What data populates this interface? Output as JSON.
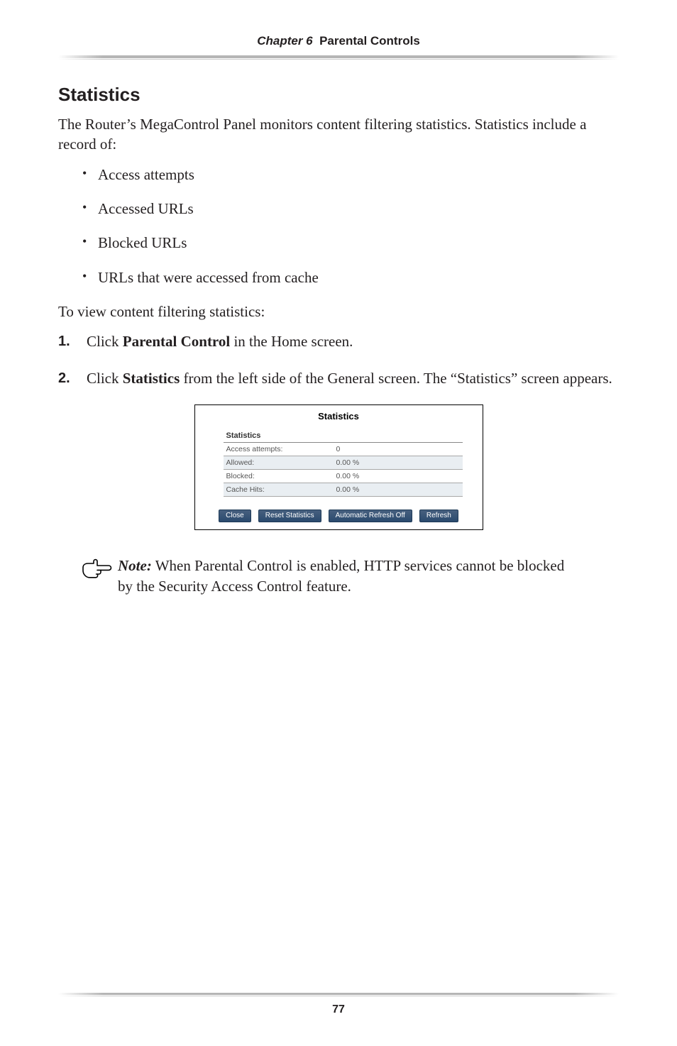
{
  "header": {
    "chapter": "Chapter 6",
    "title": "Parental Controls"
  },
  "section_heading": "Statistics",
  "intro": "The Router’s MegaControl Panel monitors content filtering statistics. Statistics include a record of:",
  "bullets": [
    "Access attempts",
    "Accessed URLs",
    "Blocked URLs",
    "URLs that were accessed from cache"
  ],
  "lead_in": "To view content filtering statistics:",
  "steps": [
    {
      "pre": "Click ",
      "bold": "Parental Control",
      "post": " in the Home screen."
    },
    {
      "pre": "Click ",
      "bold": "Statistics",
      "post": " from the left side of the General screen. The “Statistics” screen appears."
    }
  ],
  "screenshot": {
    "title": "Statistics",
    "subhead": "Statistics",
    "rows": [
      {
        "label": "Access attempts:",
        "value": "0"
      },
      {
        "label": "Allowed:",
        "value": "0.00 %"
      },
      {
        "label": "Blocked:",
        "value": "0.00 %"
      },
      {
        "label": "Cache Hits:",
        "value": "0.00 %"
      }
    ],
    "buttons": {
      "close": "Close",
      "reset": "Reset Statistics",
      "auto": "Automatic Refresh Off",
      "refresh": "Refresh"
    }
  },
  "note": {
    "label": "Note:",
    "text": " When Parental Control is enabled, HTTP services cannot be blocked by the Security Access Control feature."
  },
  "page_number": "77"
}
